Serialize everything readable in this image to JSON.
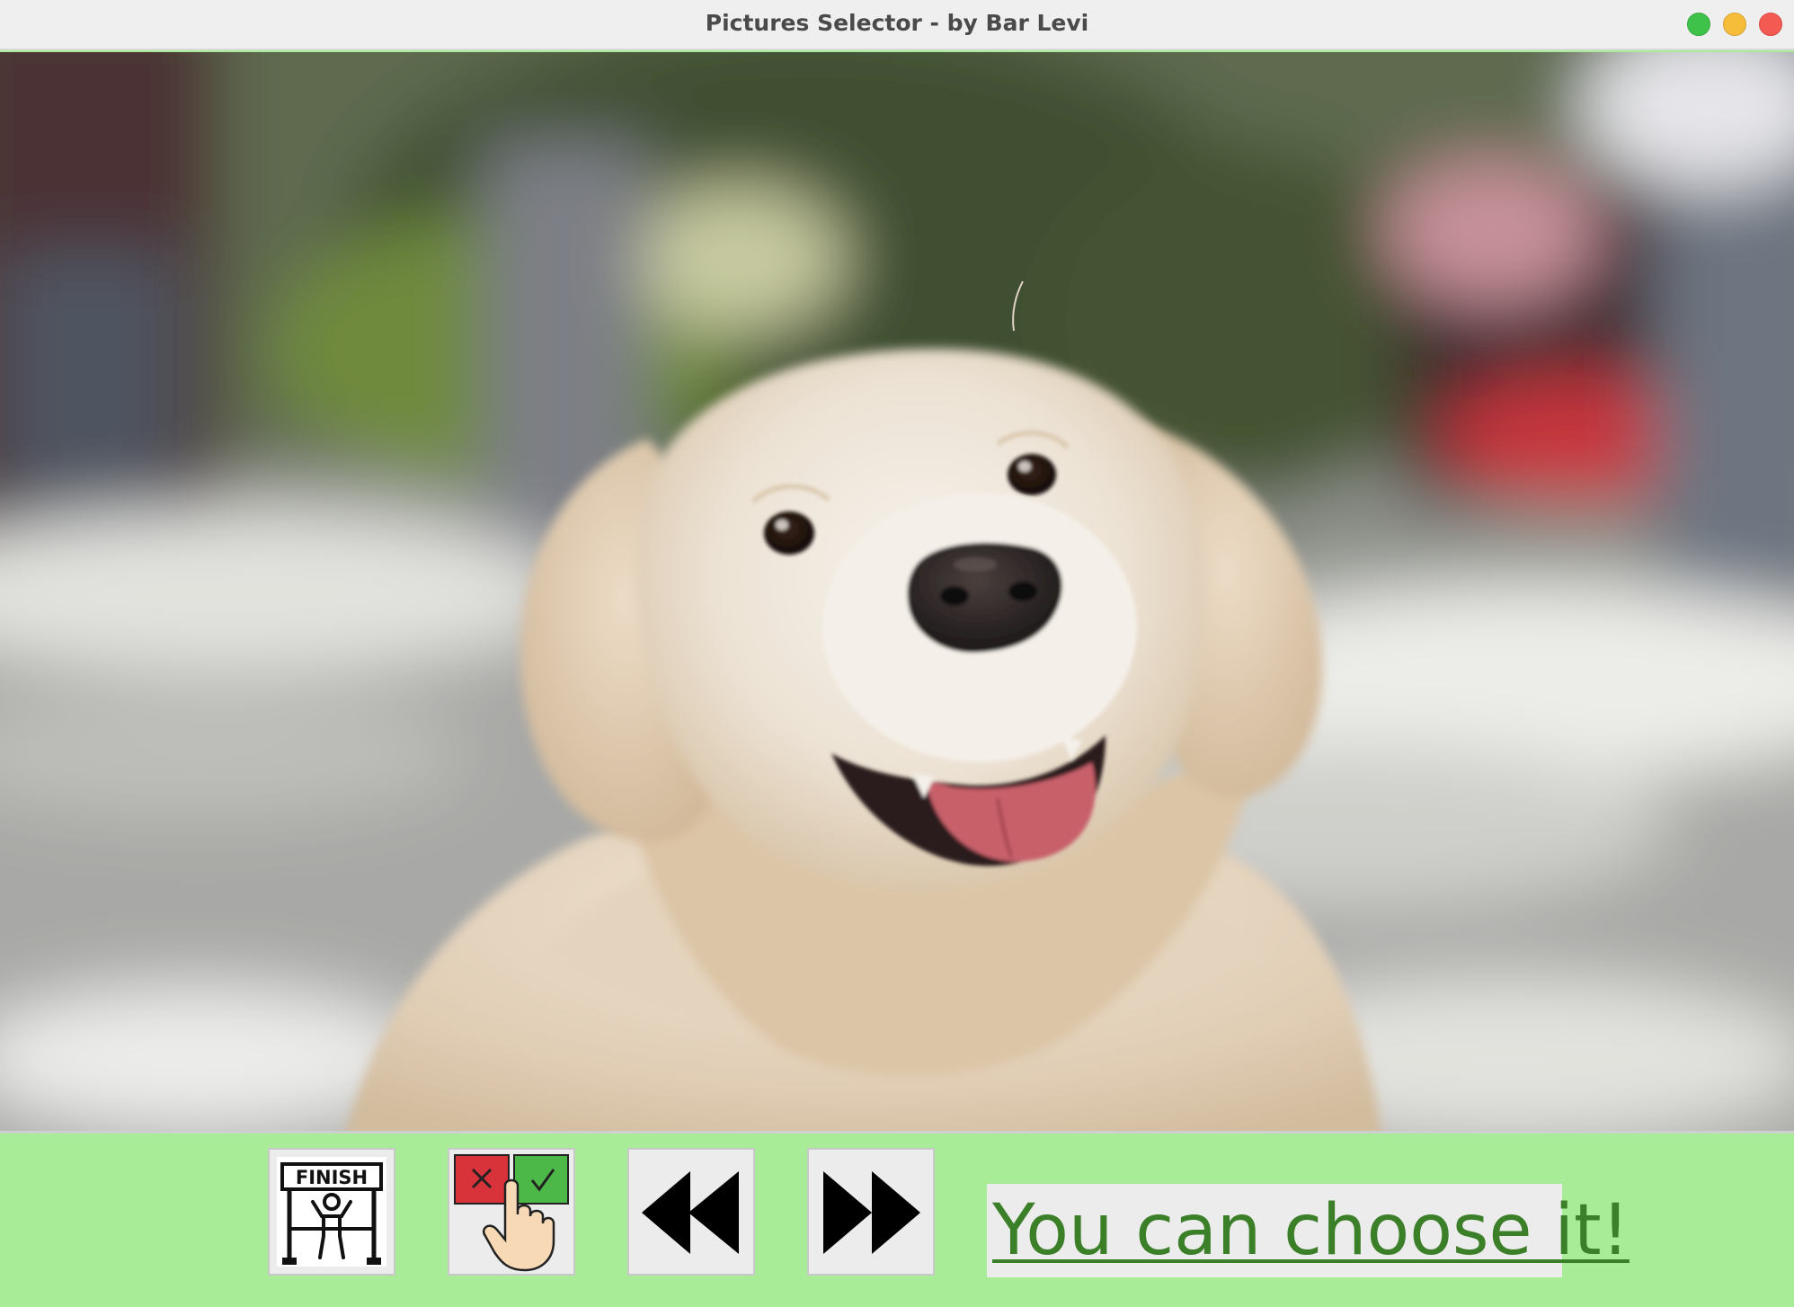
{
  "window": {
    "title": "Pictures Selector - by Bar Levi",
    "controls": [
      {
        "name": "zoom",
        "color": "#3fc24a"
      },
      {
        "name": "minimize",
        "color": "#f6bd3b"
      },
      {
        "name": "close",
        "color": "#f25a52"
      }
    ]
  },
  "photo": {
    "subject": "golden-retriever-dog-photo"
  },
  "toolbar": {
    "finish_icon_text": "FINISH",
    "buttons": [
      {
        "name": "finish-button",
        "icon": "finish-line-icon"
      },
      {
        "name": "choose-button",
        "icon": "select-x-check-icon"
      },
      {
        "name": "previous-button",
        "icon": "rewind-icon"
      },
      {
        "name": "next-button",
        "icon": "fast-forward-icon"
      }
    ],
    "status_text": "You can choose it!",
    "status_color": "#3b8028",
    "background": "#a8ec98"
  }
}
